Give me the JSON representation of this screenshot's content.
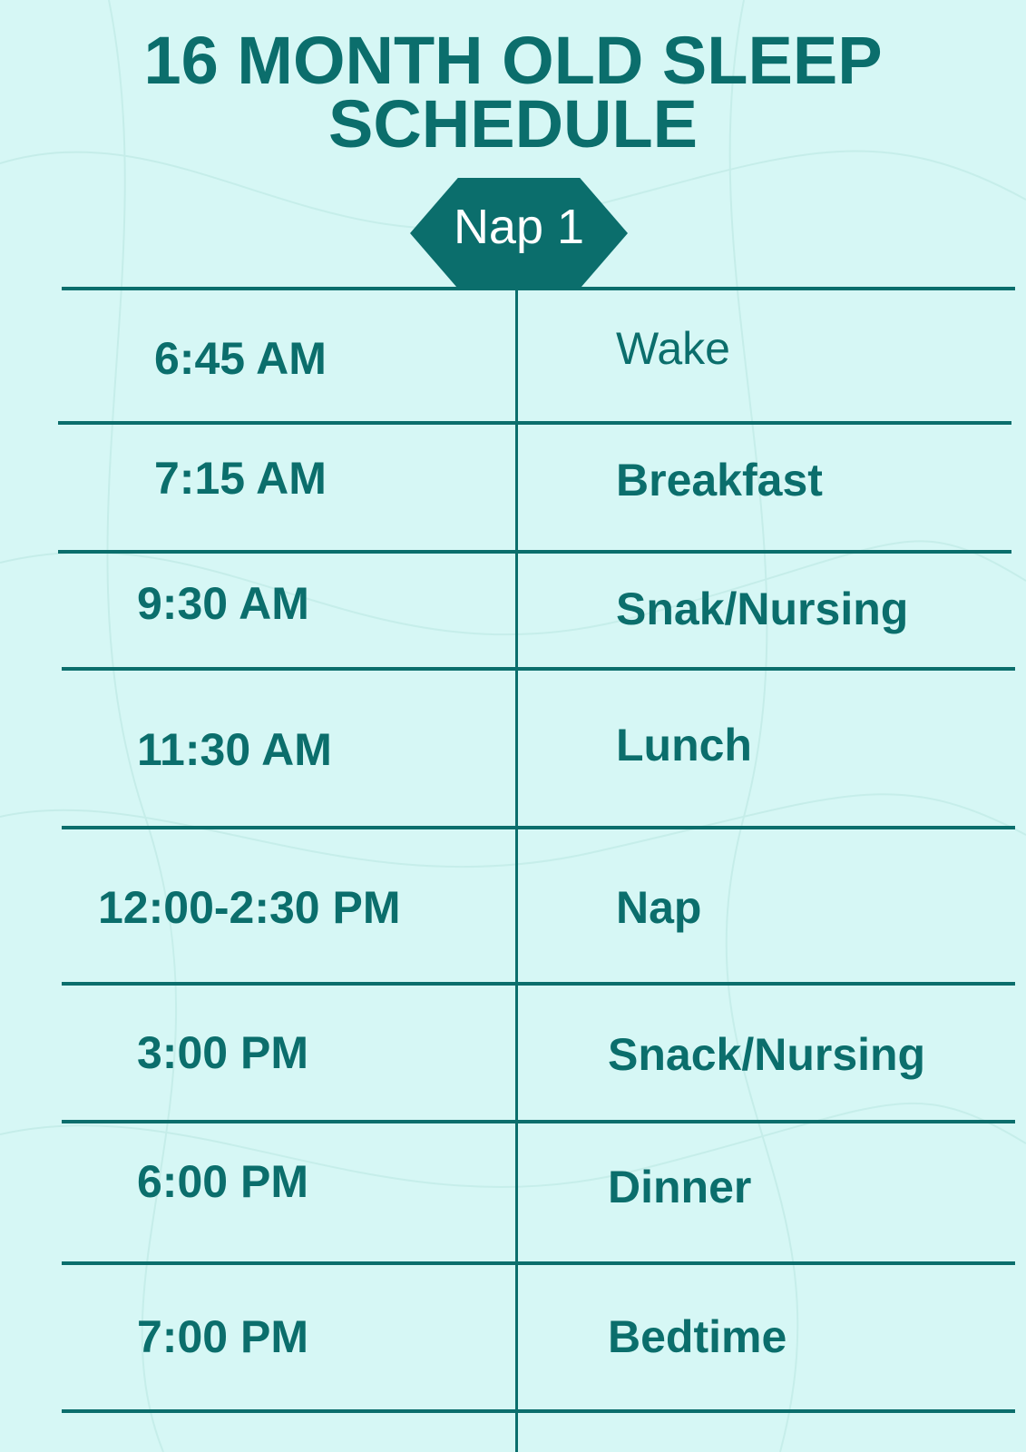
{
  "title": {
    "line1": "16 MONTH OLD SLEEP",
    "line2": "SCHEDULE"
  },
  "badge": {
    "label": "Nap 1"
  },
  "colors": {
    "accent": "#0b6e6c",
    "background": "#d6f7f5",
    "badge_text": "#ffffff"
  },
  "schedule": [
    {
      "time": "6:45 AM",
      "activity": "Wake"
    },
    {
      "time": "7:15 AM",
      "activity": "Breakfast"
    },
    {
      "time": "9:30 AM",
      "activity": "Snak/Nursing"
    },
    {
      "time": "11:30 AM",
      "activity": "Lunch"
    },
    {
      "time": "12:00-2:30 PM",
      "activity": "Nap"
    },
    {
      "time": "3:00 PM",
      "activity": "Snack/Nursing"
    },
    {
      "time": "6:00 PM",
      "activity": "Dinner"
    },
    {
      "time": "7:00 PM",
      "activity": "Bedtime"
    }
  ]
}
